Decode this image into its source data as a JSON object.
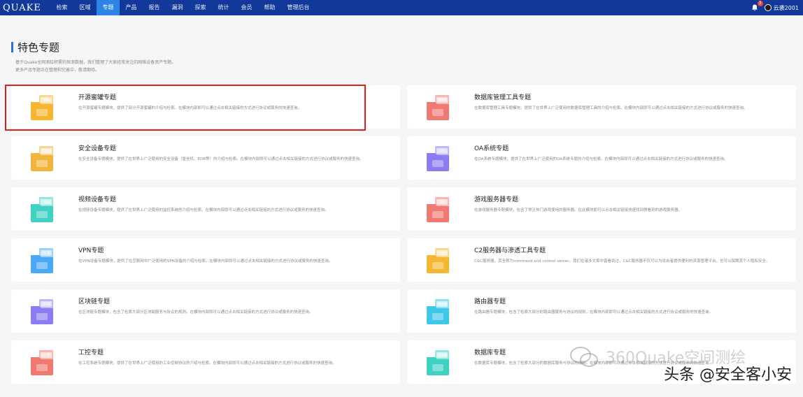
{
  "header": {
    "logo": "QUAKE",
    "nav": [
      "检索",
      "区域",
      "专题",
      "产品",
      "报告",
      "漏洞",
      "探索",
      "统计",
      "会员",
      "帮助",
      "管理后台"
    ],
    "active_index": 2,
    "notification_count": "3",
    "username": "云袭2001"
  },
  "page": {
    "title": "特色专题",
    "desc_line1": "基于Quake全网测绘积累的探测数据，我们整理了大家经常关注的网络设备资产专题。",
    "desc_line2": "更多产品专题正在整理和完善中，敬请期待。"
  },
  "cards": [
    {
      "title": "开源蜜罐专题",
      "desc": "在开源蜜罐专题模块，提供了部分开源蜜罐的介绍与检索。在模块内部即可以通过点击相关链接的方式进行协议或服务的快速查询。",
      "icon_label": "蜜罐",
      "color": "#f5b731"
    },
    {
      "title": "数据库管理工具专题",
      "desc": "在数据库管理工具专题模块，提供了在世界上广泛使用的数据库管理工具的介绍与检索。在模块内部即可以通过点击相关链接的方式进行协议或服务的快速查询。",
      "icon_label": "数据库",
      "color": "#f07a72"
    },
    {
      "title": "安全设备专题",
      "desc": "在安全设备专题模块，提供了在世界上广泛使用的安全设备（堡垒机、EDR等）的介绍与检索。在模块内部即可以通过点击相关链接的方式进行协议或服务的快速查询。",
      "icon_label": "安全设备",
      "color": "#f0b53a"
    },
    {
      "title": "OA系统专题",
      "desc": "在OA系统专题模块，提供了在世界上广泛使用的OA系统专题的介绍与检索。在模块内部即可以通过点击相关链接的方式进行协议或服务的快速查询。",
      "icon_label": "OA",
      "color": "#8a7cf2"
    },
    {
      "title": "视频设备专题",
      "desc": "在视频设备专题模块，提供了在世界上广泛使用的监控系统的介绍与检索。在模块内部即可以通过点击相关链接的方式进行协议或服务的快速查询。",
      "icon_label": "视频",
      "color": "#3ed1c4"
    },
    {
      "title": "游戏服务器专题",
      "desc": "在游戏服务器专题模块，包含了常见热门游戏使用的服务器。在此模块即可以点击相关链接快速找到想看到的游戏服务器。",
      "icon_label": "游戏",
      "color": "#f07a72"
    },
    {
      "title": "VPN专题",
      "desc": "在VPN设备专题模块，提供了在互联网中广泛使用的VPN设备的介绍与检索。在模块内部即可以通过点击相关链接的方式进行协议或服务的快速查询。",
      "icon_label": "VPN",
      "color": "#4aa8f5"
    },
    {
      "title": "C2服务器与渗透工具专题",
      "desc": "C&C服务器，其全称为command and control server。我们在诸多文章中曾看到过，C&C服务器不仅可以为攻击者提供便利的资源管理平台，也可以保障其个人隐私安全。",
      "icon_label": "C&C",
      "color": "#f5b731"
    },
    {
      "title": "区块链专题",
      "desc": "在区块链专题模块，包含了检索大部分区块链服务与协议的规则。在模块内部即可以通过点击相关链接的方式进行协议或服务的快速查询。",
      "icon_label": "区块链",
      "color": "#8a7cf2"
    },
    {
      "title": "路由器专题",
      "desc": "在路由器专题模块，包含了检索大部分的路由器服务与协议的规则。在模块内部即可以通过点击相关链接的方式进行协议或服务的快速查询。",
      "icon_label": "路由器",
      "color": "#3ec7e6"
    },
    {
      "title": "工控专题",
      "desc": "在工控系统专题模块，提供了在世界上广泛使用的工业控制协议的介绍与检索。在模块内部即可以通过点击相关链接的方式进行协议或服务的快速查询。",
      "icon_label": "工控",
      "color": "#f07a72"
    },
    {
      "title": "数据库专题",
      "desc": "在数据库专题模块，包含了检索大部分的数据库服务与协议的规则。在模块内部即可以通过点击相关链接的方式进行协议或服务的快速查询。",
      "icon_label": "数据库",
      "color": "#3ed1c4"
    }
  ],
  "watermark": {
    "channel": "360Quake空间测绘",
    "source": "头条 @安全客小安"
  }
}
